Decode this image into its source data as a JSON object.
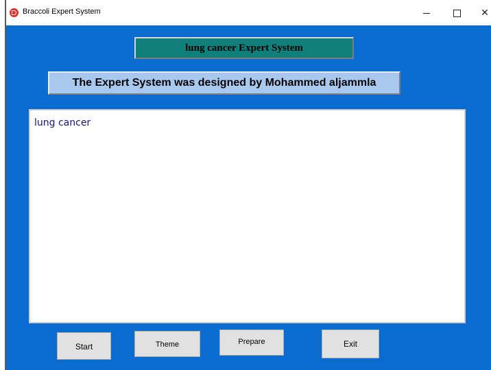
{
  "window": {
    "title": "Braccoli Expert System",
    "controls": {
      "minimize": "minimize",
      "maximize": "maximize",
      "close": "✕"
    }
  },
  "header": {
    "system_title": "lung cancer Expert System",
    "designer": "The Expert System was designed by Mohammed aljammla"
  },
  "main": {
    "output_text": "lung cancer"
  },
  "buttons": {
    "start": "Start",
    "theme": "Theme",
    "prepare": "Prepare",
    "exit": "Exit"
  },
  "colors": {
    "background": "#0b6ccf",
    "title_box": "#0e7f7a",
    "designer_box": "#a9c8ef",
    "app_icon": "#d9342b"
  }
}
